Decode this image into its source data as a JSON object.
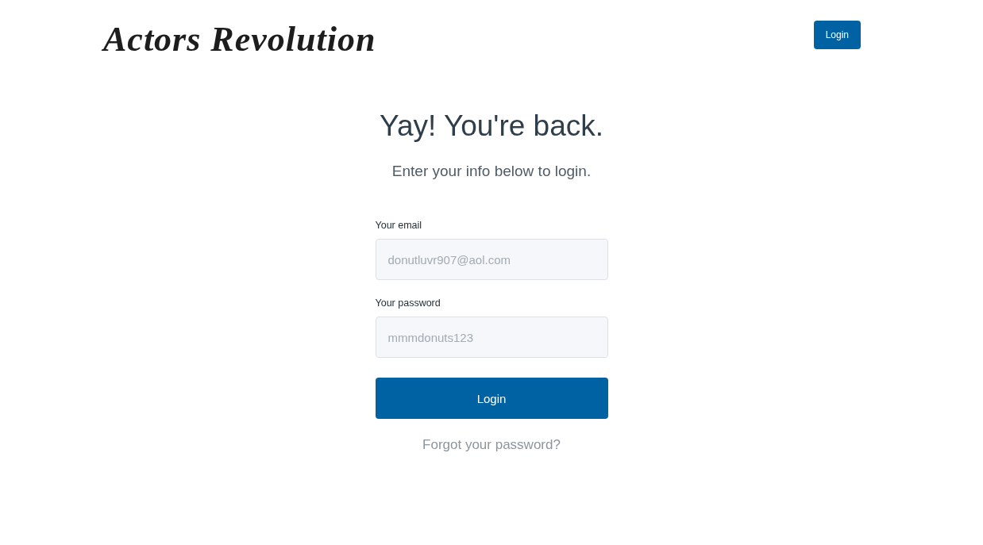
{
  "header": {
    "logo": "Actors Revolution",
    "login_button": "Login"
  },
  "title": "Yay! You're back.",
  "subtitle": "Enter your info below to login.",
  "fields": [
    {
      "label": "Your email",
      "placeholder": "donutluvr907@aol.com"
    },
    {
      "label": "Your password",
      "placeholder": "mmmdonuts123"
    }
  ],
  "submit_button": "Login",
  "forgot_link": "Forgot your password?"
}
